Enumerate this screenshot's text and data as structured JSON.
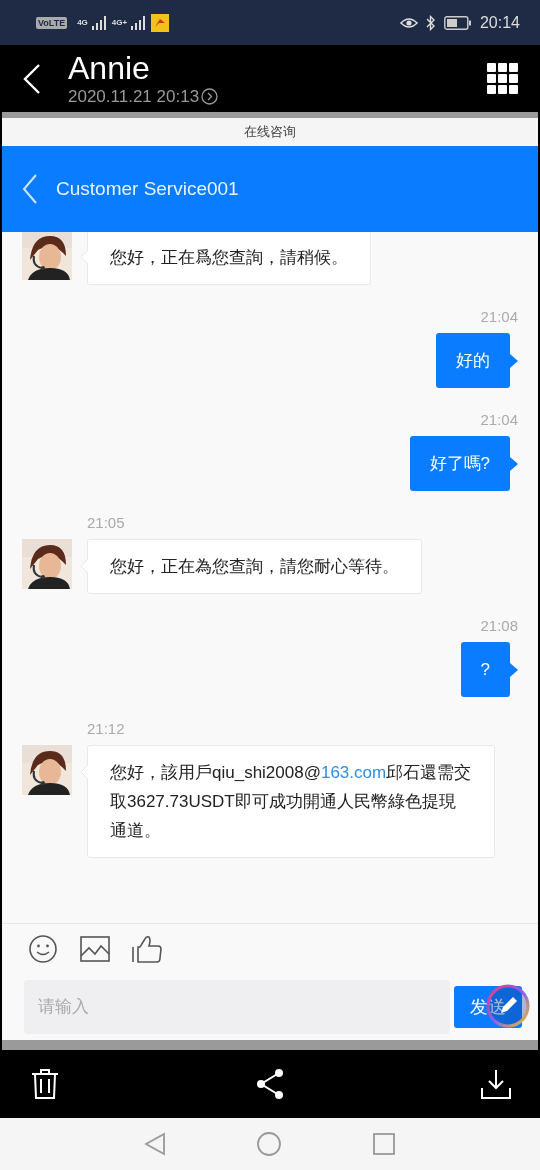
{
  "status_bar": {
    "network_labels": [
      "VoLTE",
      "4G",
      "4G+"
    ],
    "time": "20:14"
  },
  "viewer_header": {
    "title": "Annie",
    "subtitle": "2020.11.21 20:13"
  },
  "page_title": "在线咨询",
  "chat_header": {
    "title": "Customer Service001"
  },
  "messages": [
    {
      "kind": "incoming",
      "parts": [
        {
          "text": "您好，正在爲您查詢，請稍候。"
        }
      ]
    },
    {
      "kind": "outgoing",
      "time": "21:04",
      "parts": [
        {
          "text": "好的"
        }
      ]
    },
    {
      "kind": "outgoing",
      "time": "21:04",
      "parts": [
        {
          "text": "好了嗎?"
        }
      ]
    },
    {
      "kind": "incoming",
      "time": "21:05",
      "parts": [
        {
          "text": "您好，正在為您查詢，請您耐心等待。"
        }
      ]
    },
    {
      "kind": "outgoing",
      "time": "21:08",
      "parts": [
        {
          "text": "?"
        }
      ]
    },
    {
      "kind": "incoming",
      "time": "21:12",
      "parts": [
        {
          "text": "您好，該用戶qiu_shi2008@"
        },
        {
          "text": "163.com",
          "kind": "link"
        },
        {
          "text": "邱石還需交取3627.73USDT即可成功開通人民幣綠色提現通道。"
        }
      ]
    }
  ],
  "input": {
    "placeholder": "请输入",
    "send_label": "发送"
  }
}
